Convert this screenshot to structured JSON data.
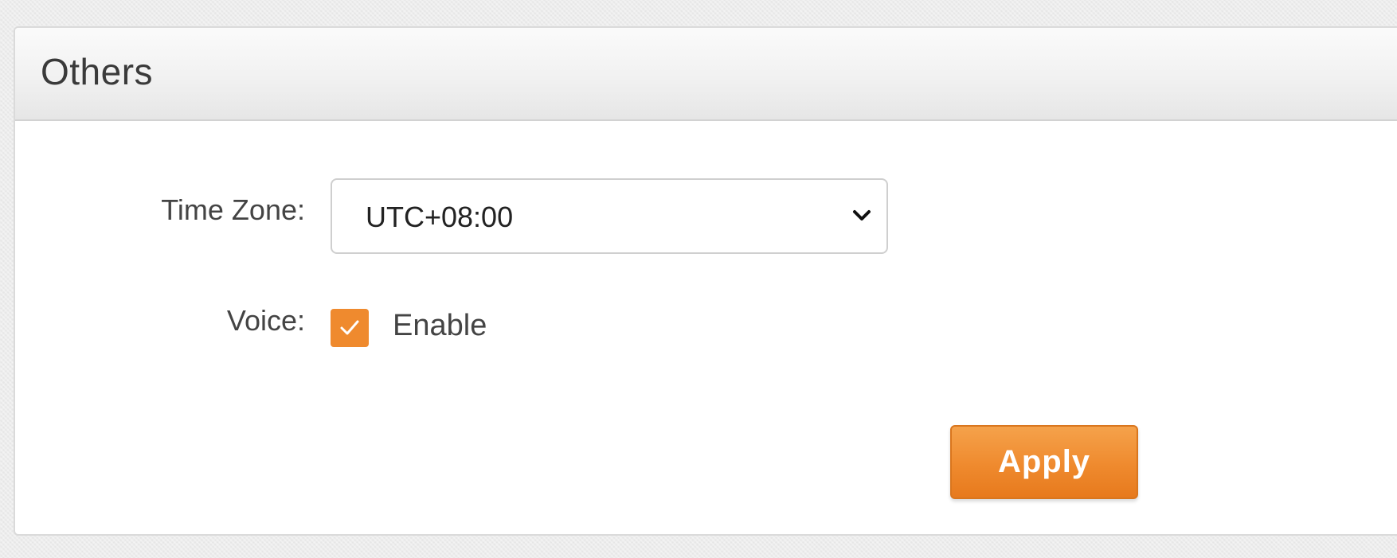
{
  "panel": {
    "title": "Others"
  },
  "time_zone": {
    "label": "Time Zone:",
    "selected": "UTC+08:00"
  },
  "voice": {
    "label": "Voice:",
    "checkbox_checked": true,
    "checkbox_label": "Enable"
  },
  "actions": {
    "apply_label": "Apply"
  },
  "icons": {
    "dropdown": "chevron-down-icon",
    "check": "check-icon"
  },
  "colors": {
    "accent": "#ef8a2e",
    "panel_background": "#ffffff",
    "page_background": "#ececec",
    "text": "#444444"
  }
}
